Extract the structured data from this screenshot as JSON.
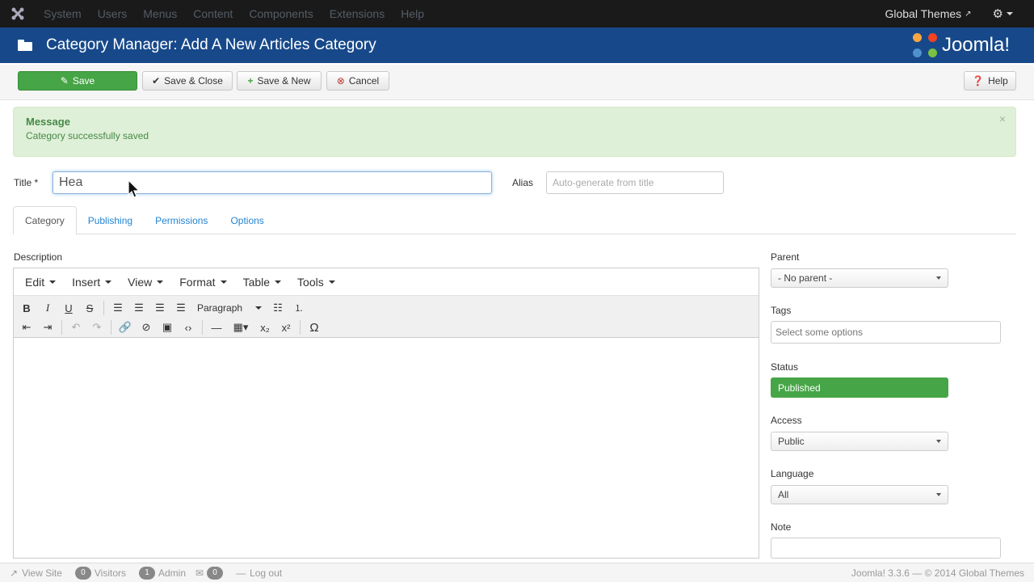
{
  "topnav": {
    "menu": [
      "System",
      "Users",
      "Menus",
      "Content",
      "Components",
      "Extensions",
      "Help"
    ],
    "site_label": "Global Themes",
    "gear": "⚙"
  },
  "header": {
    "title": "Category Manager: Add A New Articles Category",
    "brand": "Joomla!"
  },
  "toolbar": {
    "save": "Save",
    "save_close": "Save & Close",
    "save_new": "Save & New",
    "cancel": "Cancel",
    "help": "Help"
  },
  "message": {
    "heading": "Message",
    "text": "Category successfully saved",
    "close": "×"
  },
  "form": {
    "title_label": "Title *",
    "title_value": "Hea",
    "alias_label": "Alias",
    "alias_placeholder": "Auto-generate from title"
  },
  "tabs": [
    "Category",
    "Publishing",
    "Permissions",
    "Options"
  ],
  "editor": {
    "label": "Description",
    "menu": [
      "Edit",
      "Insert",
      "View",
      "Format",
      "Table",
      "Tools"
    ],
    "format_select": "Paragraph"
  },
  "sidebar": {
    "parent_label": "Parent",
    "parent_value": "- No parent -",
    "tags_label": "Tags",
    "tags_placeholder": "Select some options",
    "status_label": "Status",
    "status_value": "Published",
    "access_label": "Access",
    "access_value": "Public",
    "language_label": "Language",
    "language_value": "All",
    "note_label": "Note"
  },
  "footer": {
    "view_site": "View Site",
    "visitors_count": "0",
    "visitors": "Visitors",
    "admin_count": "1",
    "admin": "Admin",
    "messages_count": "0",
    "logout": "Log out",
    "copyright": "Joomla! 3.3.6 — © 2014 Global Themes"
  },
  "colors": {
    "topnav": "#1a1a1a",
    "header": "#17498a",
    "save_button": "#46a546",
    "message_bg": "#dff0d8",
    "link": "#2384d3"
  }
}
